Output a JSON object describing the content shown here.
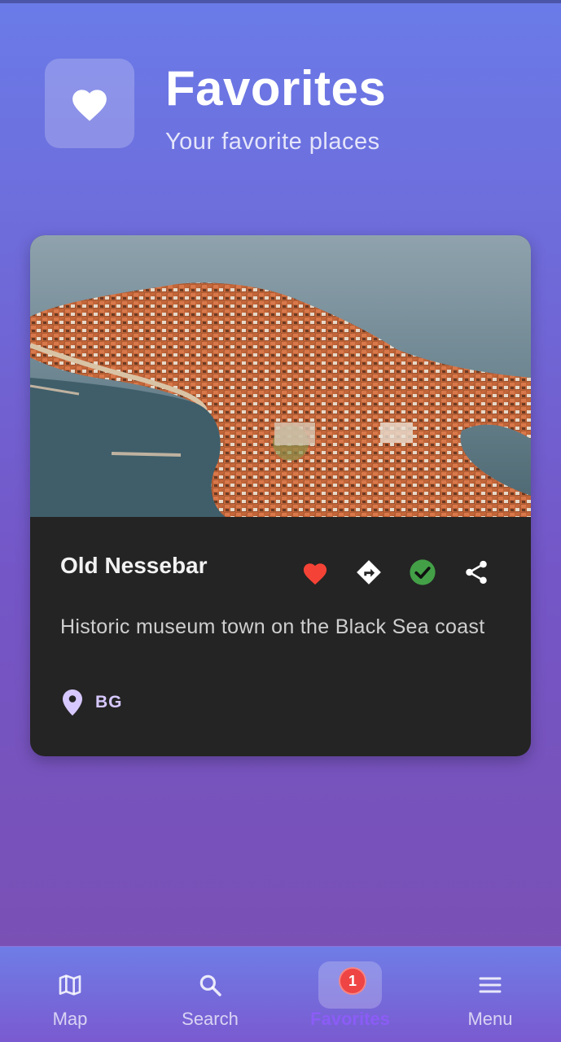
{
  "header": {
    "icon": "heart-icon",
    "title": "Favorites",
    "subtitle": "Your favorite places"
  },
  "place": {
    "name": "Old Nessebar",
    "description": "Historic museum town on the Black Sea coast",
    "country_code": "BG",
    "image_subject": "Aerial photo of a peninsula town with red-tiled roofs surrounded by sea",
    "actions": [
      {
        "icon": "heart-icon",
        "color": "#f44336"
      },
      {
        "icon": "directions-icon",
        "color": "#ffffff"
      },
      {
        "icon": "check-circle-icon",
        "color": "#43a047"
      },
      {
        "icon": "share-icon",
        "color": "#ffffff"
      }
    ]
  },
  "nav": {
    "items": [
      {
        "label": "Map",
        "icon": "map-icon"
      },
      {
        "label": "Search",
        "icon": "search-icon"
      },
      {
        "label": "Favorites",
        "icon": "favorites-icon",
        "badge": "1",
        "active": true
      },
      {
        "label": "Menu",
        "icon": "menu-icon"
      }
    ]
  },
  "colors": {
    "accent": "#8b5cf6",
    "card_background": "#242424",
    "badge": "#ef4444"
  }
}
